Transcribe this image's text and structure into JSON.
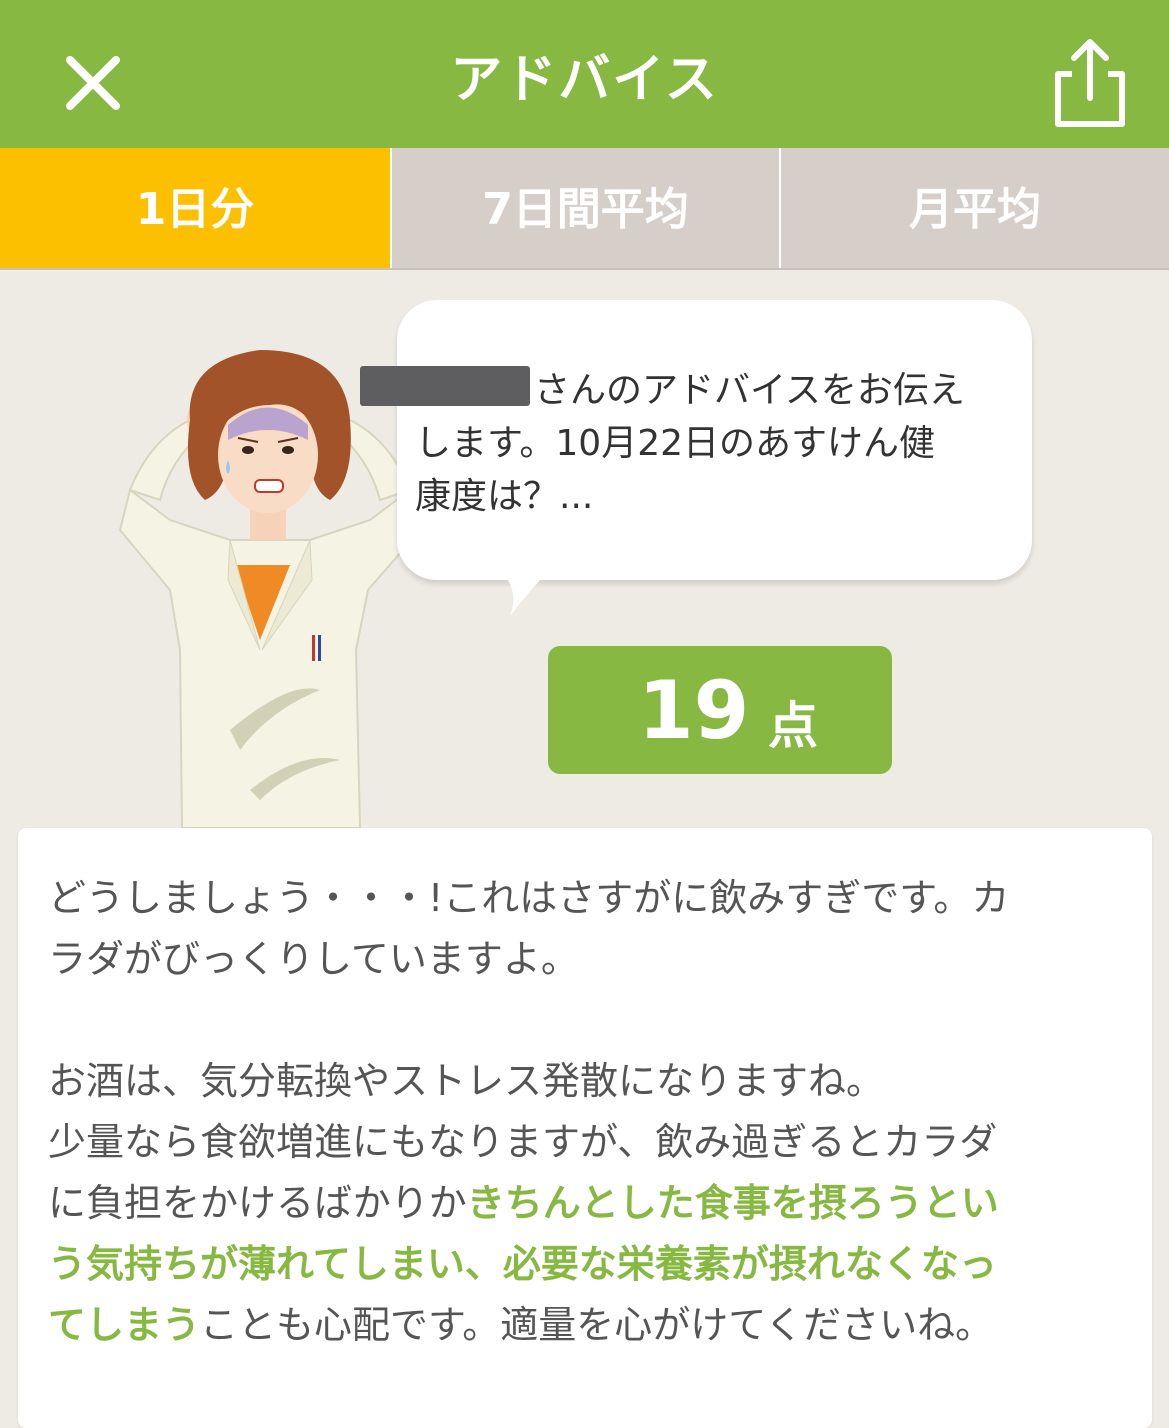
{
  "header": {
    "title": "アドバイス",
    "close_icon": "close-icon",
    "share_icon": "share-icon"
  },
  "tabs": [
    {
      "label": "1日分",
      "active": true
    },
    {
      "label": "7日間平均",
      "active": false
    },
    {
      "label": "月平均",
      "active": false
    }
  ],
  "bubble": {
    "line1": "さんのアドバイスをお伝え",
    "line2": "します。10月22日のあすけん健",
    "line3": "康度は？..."
  },
  "score": {
    "value": "19",
    "unit": "点"
  },
  "advice": {
    "p1_l1": "どうしましょう・・・!これはさすがに飲みすぎです。カ",
    "p1_l2": "ラダがびっくりしていますよ。",
    "p2_l1": "お酒は、気分転換やストレス発散になりますね。",
    "p2_l2": "少量なら食欲増進にもなりますが、飲み過ぎるとカラダ",
    "p2_l3a": "に負担をかけるばかりか",
    "p2_l3b": "きちんとした食事を摂ろうとい",
    "p2_l4": "う気持ちが薄れてしまい、必要な栄養素が摂れなくなっ",
    "p2_l5a": "てしまう",
    "p2_l5b": "ことも心配です。適量を心がけてくださいね。"
  },
  "colors": {
    "brand_green": "#86B842",
    "active_tab": "#FDC000",
    "inactive_tab": "#D6CFC9",
    "background": "#EEEBE5"
  }
}
